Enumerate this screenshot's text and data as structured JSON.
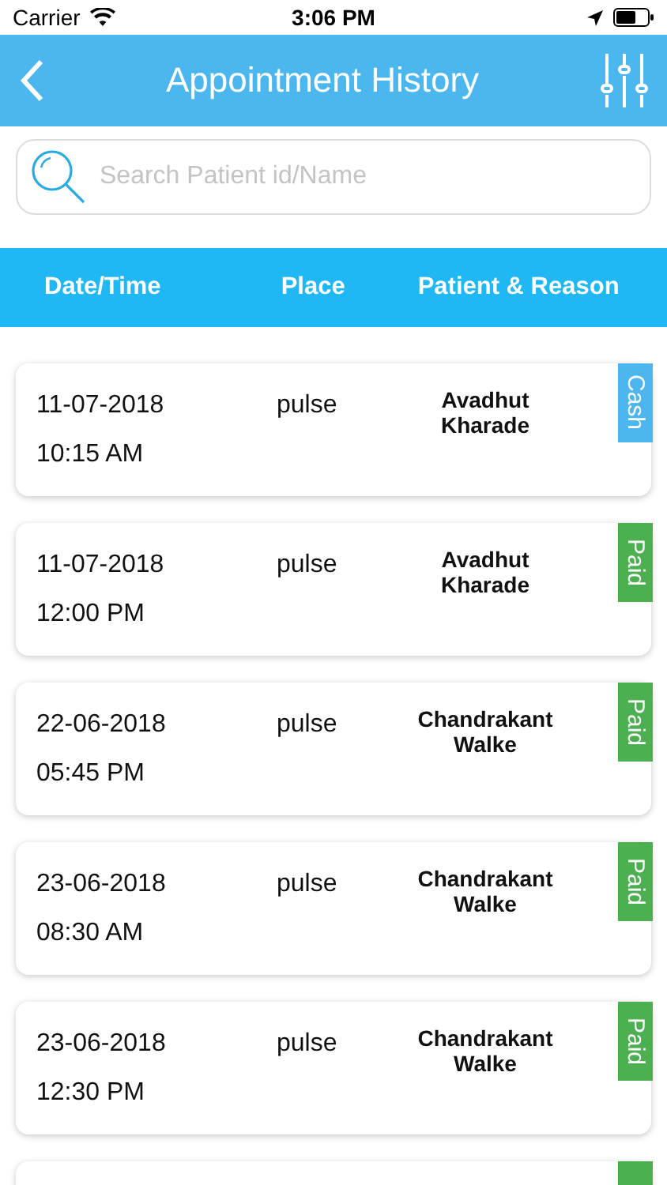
{
  "status_bar": {
    "carrier": "Carrier",
    "time": "3:06 PM"
  },
  "header": {
    "title": "Appointment History"
  },
  "search": {
    "placeholder": "Search Patient id/Name"
  },
  "columns": [
    "Date/Time",
    "Place",
    "Patient & Reason"
  ],
  "appointments": [
    {
      "date": "11-07-2018",
      "time": "10:15 AM",
      "place": "pulse",
      "patient": "Avadhut Kharade",
      "badge": "Cash",
      "kind": "cash"
    },
    {
      "date": "11-07-2018",
      "time": "12:00 PM",
      "place": "pulse",
      "patient": "Avadhut Kharade",
      "badge": "Paid",
      "kind": "paid"
    },
    {
      "date": "22-06-2018",
      "time": "05:45 PM",
      "place": "pulse",
      "patient": "Chandrakant Walke",
      "badge": "Paid",
      "kind": "paid"
    },
    {
      "date": "23-06-2018",
      "time": "08:30 AM",
      "place": "pulse",
      "patient": "Chandrakant Walke",
      "badge": "Paid",
      "kind": "paid"
    },
    {
      "date": "23-06-2018",
      "time": "12:30 PM",
      "place": "pulse",
      "patient": "Chandrakant Walke",
      "badge": "Paid",
      "kind": "paid"
    },
    {
      "kind": "paid"
    }
  ]
}
